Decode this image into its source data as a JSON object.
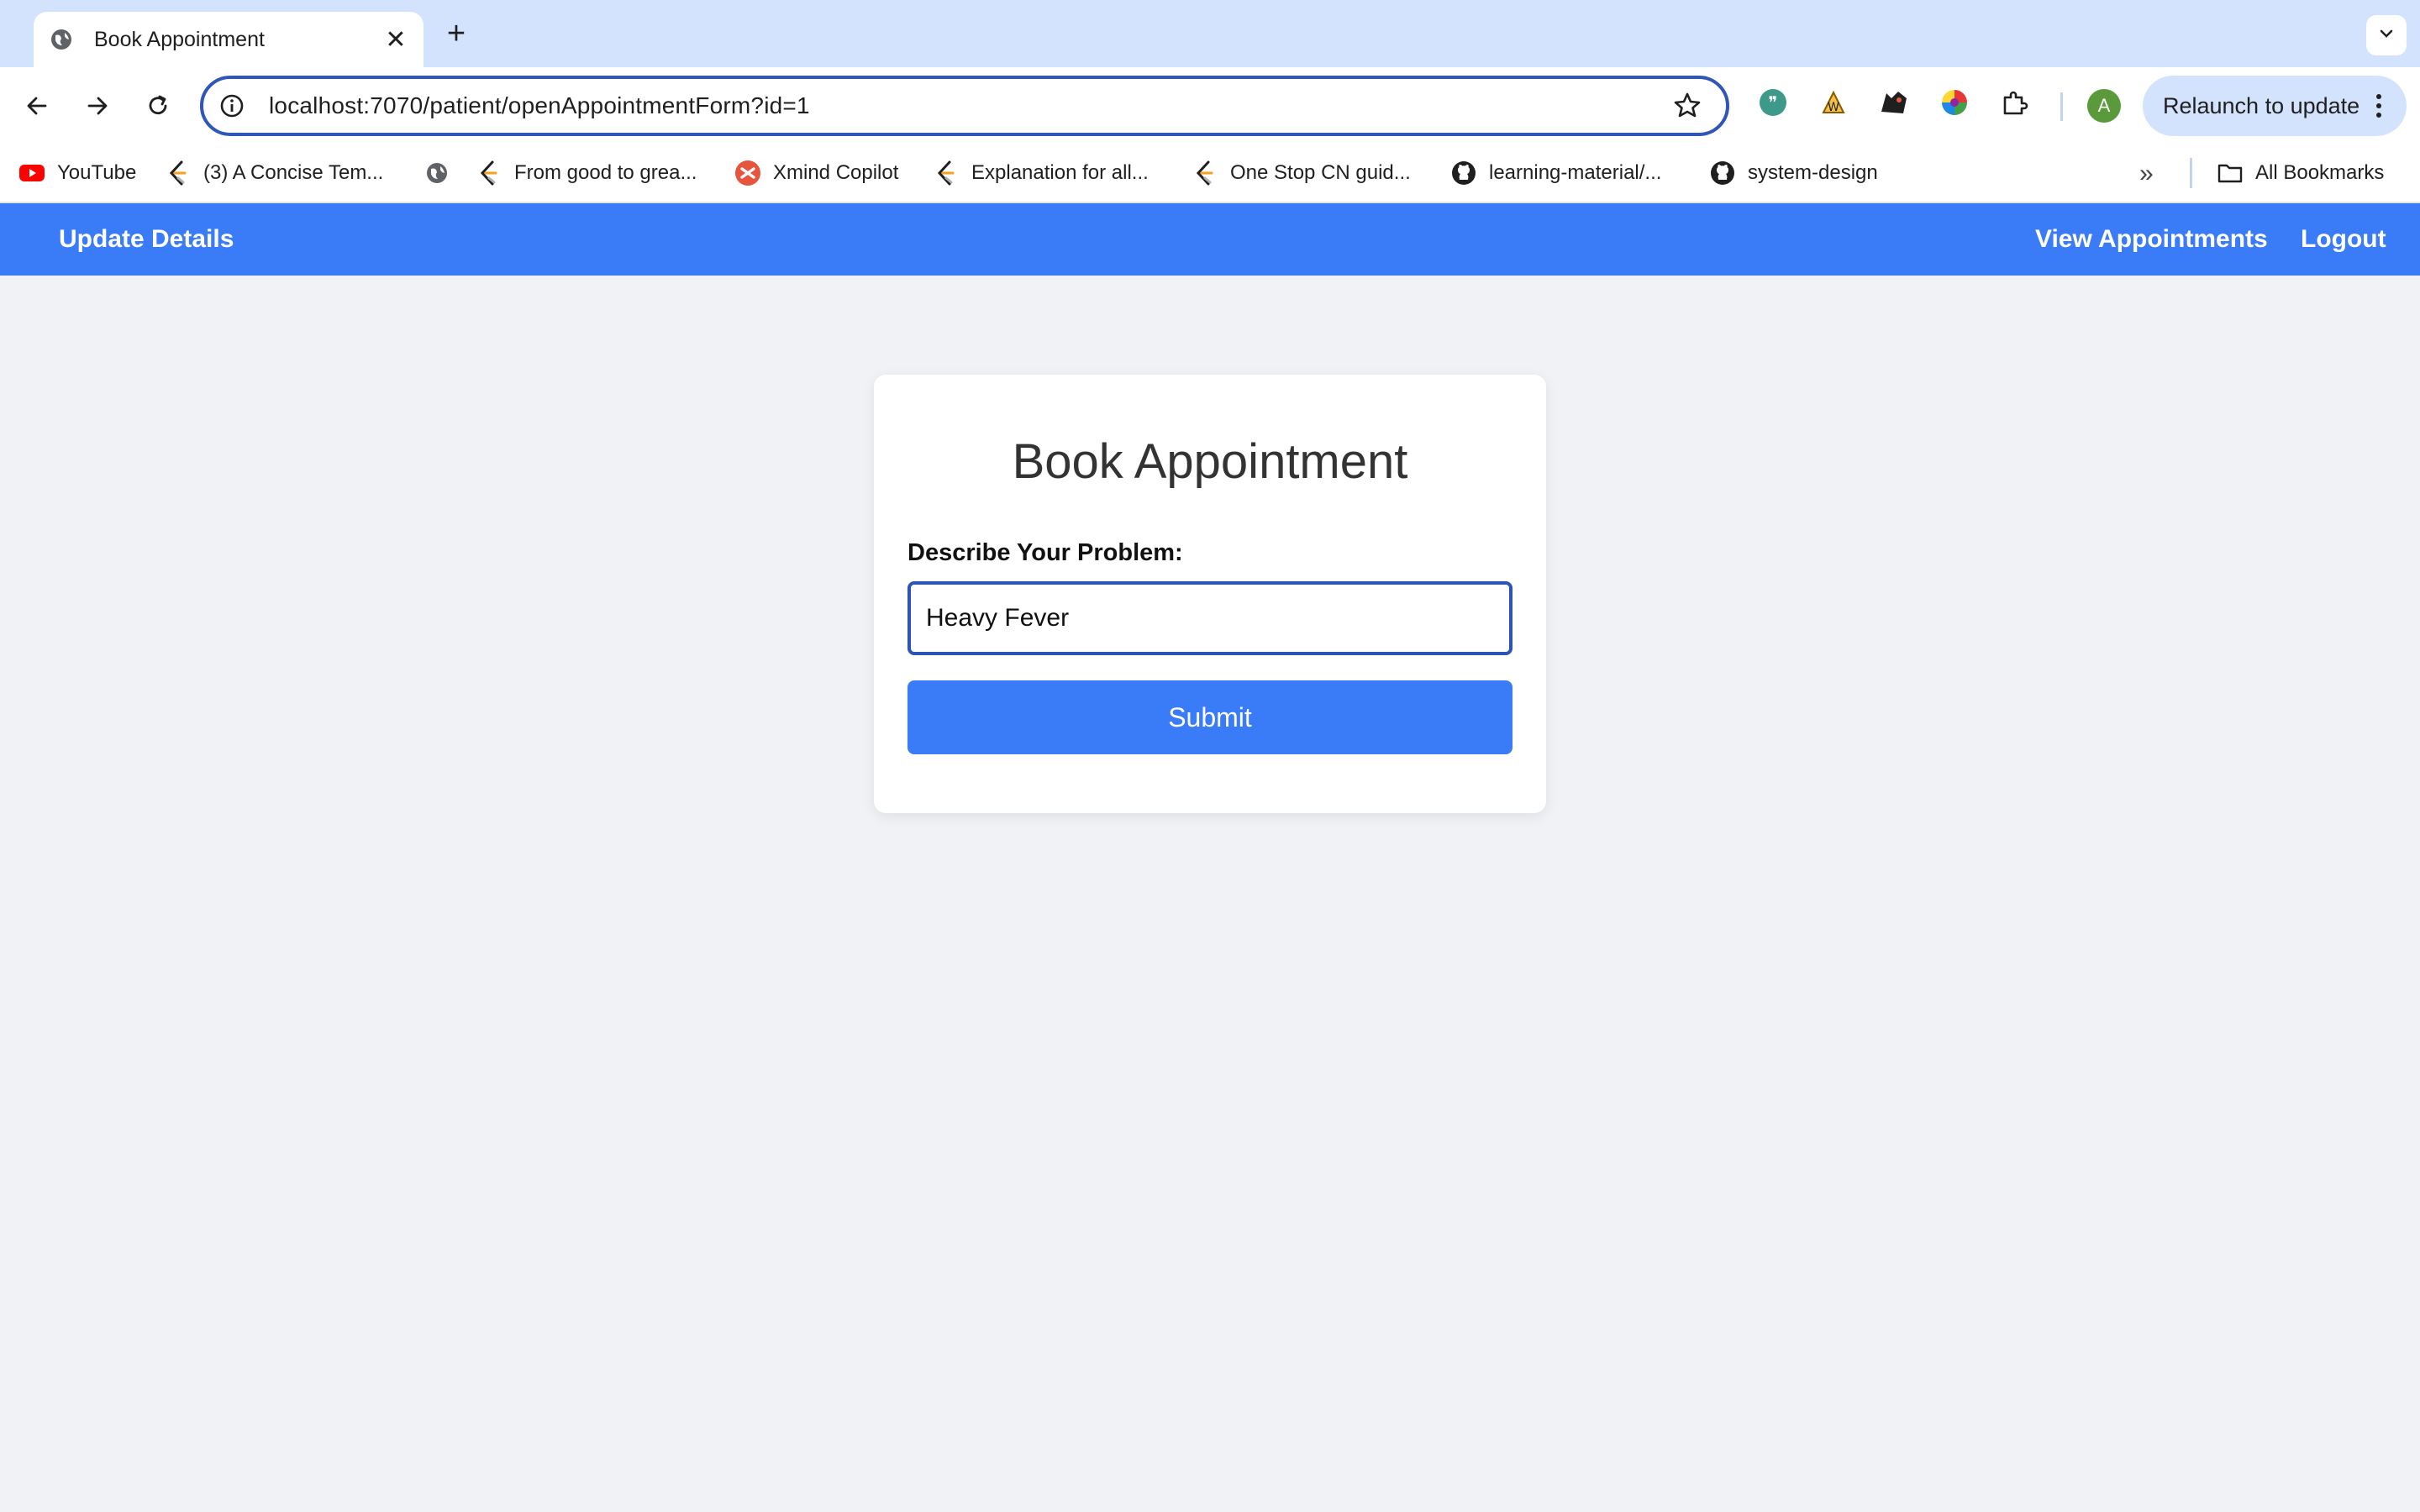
{
  "browser": {
    "tab_title": "Book Appointment",
    "close_symbol": "✕",
    "new_tab_symbol": "+",
    "url": "localhost:7070/patient/openAppointmentForm?id=1",
    "profile_initial": "A",
    "relaunch_label": "Relaunch to update",
    "bookmarks": [
      {
        "label": "YouTube",
        "icon": "youtube-icon"
      },
      {
        "label": "(3) A Concise Tem...",
        "icon": "leetcode-icon"
      },
      {
        "label": "",
        "icon": "globe-icon"
      },
      {
        "label": "From good to grea...",
        "icon": "leetcode-icon"
      },
      {
        "label": "Xmind Copilot",
        "icon": "xmind-icon"
      },
      {
        "label": "Explanation for all...",
        "icon": "leetcode-icon"
      },
      {
        "label": "One Stop CN guid...",
        "icon": "leetcode-icon"
      },
      {
        "label": "learning-material/...",
        "icon": "github-icon"
      },
      {
        "label": "system-design",
        "icon": "github-icon"
      }
    ],
    "bookmarks_overflow_symbol": "»",
    "all_bookmarks_label": "All Bookmarks"
  },
  "navbar": {
    "update_details": "Update Details",
    "view_appointments": "View Appointments",
    "logout": "Logout",
    "color": "#3a7bf7"
  },
  "form": {
    "title": "Book Appointment",
    "problem_label": "Describe Your Problem:",
    "problem_value": "Heavy Fever",
    "submit_label": "Submit"
  }
}
